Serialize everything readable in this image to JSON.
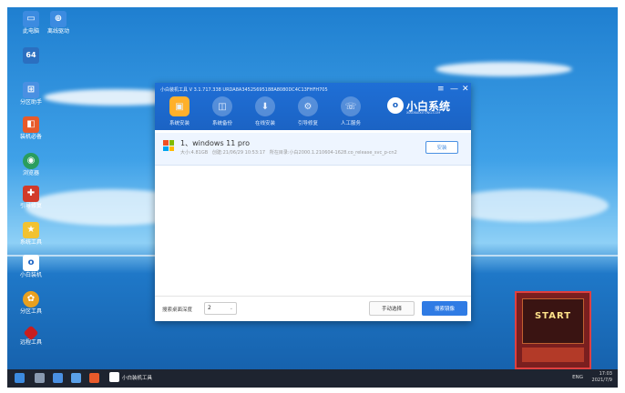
{
  "desktop": {
    "icons": [
      {
        "label": "此电脑",
        "icon": "computer-icon",
        "color": "#3c8be0"
      },
      {
        "label": "离线驱动",
        "icon": "network-icon",
        "color": "#3c8be0"
      },
      {
        "label": "64",
        "icon": "64bit-icon",
        "color": "#2b6fc0"
      },
      {
        "label": "分区助手",
        "icon": "partition-icon",
        "color": "#4a90e2"
      },
      {
        "label": "装机必备",
        "icon": "tools-icon",
        "color": "#e85a2a"
      },
      {
        "label": "浏览器",
        "icon": "browser-icon",
        "color": "#2a9d5e"
      },
      {
        "label": "引导修复",
        "icon": "repair-icon",
        "color": "#d23a2a"
      },
      {
        "label": "系统工具",
        "icon": "star-tool-icon",
        "color": "#f2c230"
      },
      {
        "label": "小白装机",
        "icon": "xiaobai-icon",
        "color": "#1b63c4"
      },
      {
        "label": "分区工具",
        "icon": "flower-icon",
        "color": "#e8a020"
      },
      {
        "label": "远程工具",
        "icon": "diamond-icon",
        "color": "#c81e1e"
      }
    ]
  },
  "installer": {
    "title": "小白装机工具 V 3.1.717.338 URDA8A34525695188A8080DC4C13FHFH705",
    "controls": [
      "≡",
      "—",
      "✕"
    ],
    "toolbar": [
      {
        "label": "系统安装",
        "active": true
      },
      {
        "label": "系统备份",
        "active": false
      },
      {
        "label": "在线安装",
        "active": false
      },
      {
        "label": "引导修复",
        "active": false
      },
      {
        "label": "人工服务",
        "active": false
      }
    ],
    "brand_name": "小白系统",
    "brand_url": "XIAOBAIXITONG.COM",
    "os_item": {
      "name": "1、windows 11 pro",
      "size": "大小:4.81GB",
      "date": "创建:21/06/29 10:53:17",
      "path": "所在目录:小白2000.1.210604-1628.co_release_svc_p-cn2",
      "button": "安装"
    },
    "footer": {
      "depth_label": "搜索桌面深度",
      "depth_value": "2",
      "manual_button": "手动选择",
      "online_button": "搜索镜像"
    }
  },
  "ad": {
    "text": "START"
  },
  "taskbar": {
    "app_label": "小白装机工具",
    "tray": "ENG",
    "time": "17:03",
    "date": "2021/7/9"
  }
}
